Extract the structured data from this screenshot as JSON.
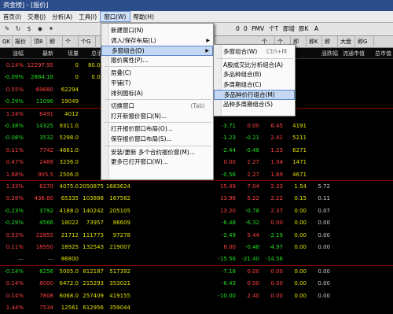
{
  "window": {
    "title": "资金榜] - [报价]"
  },
  "menubar": [
    "首页(I)",
    "交易(J)",
    "分析(A)",
    "工具(I)",
    "窗口(W)",
    "帮助(H)"
  ],
  "toolbar": {
    "icons": [
      "edit-icon",
      "refresh-icon",
      "dollar-icon",
      "tag-icon",
      "pin-icon"
    ],
    "labels": [
      "0",
      "0",
      "PMV",
      "个T",
      "即增",
      "即K",
      "A"
    ]
  },
  "quickbar": [
    "QK",
    "报价",
    "顶8",
    "即",
    "个",
    "个G",
    "个",
    "个",
    "即增",
    "即K",
    "即额",
    "即",
    "即",
    "即胜",
    "即盘",
    "大盘",
    "即",
    "即",
    "即G"
  ],
  "columns": [
    "涨幅",
    "最新",
    "现量",
    "总手",
    "",
    "",
    "",
    "",
    "",
    "",
    "",
    "",
    "",
    "",
    "涨跌幅",
    "流通市值",
    "总市值",
    "上市"
  ],
  "rows": [
    {
      "chg": "0.14%",
      "last": "12297.95",
      "vol": "0",
      "hand": "80.00",
      "amt": "1631741.27",
      "c": "red"
    },
    {
      "chg": "-0.09%",
      "last": "2884.18",
      "vol": "0",
      "hand": "0.00",
      "amt": "1267355",
      "c": "green"
    },
    {
      "chg": "0.55%",
      "last": "69680",
      "vol": "62294",
      "hand": "",
      "amt": "7391",
      "c": "red"
    },
    {
      "chg": "-0.29%",
      "last": "11096",
      "vol": "19049",
      "hand": "",
      "amt": "1551",
      "c": "green"
    },
    {
      "chg": "1.24%",
      "last": "6491",
      "vol": "4012",
      "hand": "",
      "amt": "6339",
      "c": "red"
    },
    {
      "chg": "-0.38%",
      "last": "14325",
      "vol": "9311.0",
      "hand": "",
      "amt": "3000",
      "c": "green"
    },
    {
      "chg": "-0.08%",
      "last": "3532",
      "vol": "5298.0",
      "hand": "",
      "amt": "4231",
      "c": "green"
    },
    {
      "chg": "0.11%",
      "last": "7742",
      "vol": "4661.0",
      "hand": "",
      "amt": "4431",
      "c": "red"
    },
    {
      "chg": "0.47%",
      "last": "2488",
      "vol": "3236.0",
      "hand": "",
      "amt": "1121",
      "c": "red"
    },
    {
      "chg": "1.68%",
      "last": "905.5",
      "vol": "2506.0",
      "hand": "",
      "amt": "2310",
      "c": "red"
    },
    {
      "chg": "1.33%",
      "last": "6270",
      "vol": "4075.0",
      "hand": "2050875",
      "amt": "1683624",
      "c": "red"
    },
    {
      "chg": "0.29%",
      "last": "436.80",
      "vol": "65335",
      "hand": "103888",
      "amt": "167582",
      "c": "red"
    },
    {
      "chg": "-0.23%",
      "last": "3792",
      "vol": "4188.0",
      "hand": "140242",
      "amt": "205105",
      "c": "green"
    },
    {
      "chg": "-0.29%",
      "last": "4566",
      "vol": "18022",
      "hand": "73957",
      "amt": "86609",
      "c": "green"
    },
    {
      "chg": "0.53%",
      "last": "22855",
      "vol": "21712",
      "hand": "111773",
      "amt": "97278",
      "c": "red"
    },
    {
      "chg": "0.11%",
      "last": "18950",
      "vol": "18925",
      "hand": "132543",
      "amt": "219007",
      "c": "red"
    },
    {
      "chg": "—",
      "last": "—",
      "vol": "86800",
      "hand": "",
      "amt": "",
      "c": "gray"
    },
    {
      "chg": "-0.14%",
      "last": "8256",
      "vol": "5005.0",
      "hand": "812187",
      "amt": "517392",
      "c": "green"
    },
    {
      "chg": "0.14%",
      "last": "8000",
      "vol": "6472.0",
      "hand": "215293",
      "amt": "353021",
      "c": "red"
    },
    {
      "chg": "0.14%",
      "last": "7808",
      "vol": "6068.0",
      "hand": "257409",
      "amt": "419155",
      "c": "red"
    },
    {
      "chg": "1.44%",
      "last": "7534",
      "vol": "12561",
      "hand": "612956",
      "amt": "359044",
      "c": "red"
    }
  ],
  "midcols": [
    [
      "",
      "",
      "",
      "",
      "",
      "",
      "",
      "",
      "",
      "",
      "",
      "",
      "",
      "",
      "",
      "",
      "",
      "",
      "",
      ""
    ],
    [
      "",
      "",
      "",
      "",
      "3.55",
      "-3.71",
      "-1.23",
      "-2.44",
      "0.00",
      "-0.56",
      "15.49",
      "13.96",
      "13.20",
      "-6.48",
      "-2.49",
      "8.00",
      "-15.56",
      "-7.18",
      "-6.43",
      "-10.00"
    ]
  ],
  "rightcols": {
    "a": [
      "",
      "",
      "",
      "",
      "1.98",
      "0.00",
      "-0.21",
      "-0.48",
      "2.27",
      "2.27",
      "7.04",
      "5.22",
      "-0.78",
      "-6.32",
      "5.44",
      "-0.48",
      "-21.40",
      "0.00",
      "0.00",
      "2.40"
    ],
    "b": [
      "",
      "",
      "",
      "",
      "1.94",
      "6.45",
      "2.41",
      "1.23",
      "1.04",
      "1.69",
      "2.33",
      "2.22",
      "2.37",
      "0.00",
      "-2.19",
      "-4.97",
      "-14.56",
      "0.00",
      "0.00",
      "0.00"
    ],
    "c": [
      "",
      "",
      "",
      "",
      "",
      "4191",
      "5211",
      "6271",
      "1471",
      "4671",
      "1.54",
      "0.15",
      "0.00",
      "0.00",
      "0.00",
      "0.00",
      "",
      "0.00",
      "0.00",
      "0.00"
    ],
    "d": [
      "",
      "",
      "",
      "",
      "",
      "",
      "",
      "",
      "",
      "",
      "5.72",
      "0.11",
      "0.07",
      "0.00",
      "0.00",
      "0.00",
      "",
      "0.00",
      "0.00",
      "0.00"
    ]
  },
  "menu1": {
    "items": [
      {
        "label": "新建窗口(N)",
        "sc": ""
      },
      {
        "label": "调入/保存布局(L)",
        "sc": "",
        "arrow": true
      },
      {
        "label": "多窗组合(D)",
        "sc": "",
        "arrow": true,
        "hl": true
      },
      {
        "label": "报价属性(P)...",
        "sc": ""
      },
      {
        "label": "",
        "div": true
      },
      {
        "label": "层叠(C)",
        "sc": ""
      },
      {
        "label": "平铺(T)",
        "sc": ""
      },
      {
        "label": "排列图标(A)",
        "sc": ""
      },
      {
        "label": "",
        "div": true
      },
      {
        "label": "切换窗口",
        "sc": "(Tab)"
      },
      {
        "label": "打开新报价窗口(N)...",
        "sc": ""
      },
      {
        "label": "",
        "div": true
      },
      {
        "label": "打开报价窗口布局(O)...",
        "sc": ""
      },
      {
        "label": "保存报价窗口布局(S)...",
        "sc": ""
      },
      {
        "label": "",
        "div": true
      },
      {
        "label": "安装/更新 多个合约报价窗(M)...",
        "sc": ""
      },
      {
        "label": "更多已打开窗口(W)...",
        "sc": ""
      }
    ]
  },
  "menu2": {
    "items": [
      {
        "label": "多窗组合(W)",
        "sc": "Ctrl+M"
      },
      {
        "label": "",
        "div": true
      },
      {
        "label": "A股成交比分析组合(A)",
        "sc": ""
      },
      {
        "label": "多品种组合(B)",
        "sc": ""
      },
      {
        "label": "多周期组合(C)",
        "sc": ""
      },
      {
        "label": "多品种价行组合(M)",
        "sc": "",
        "hl": true
      },
      {
        "label": "品种多周期组合(S)",
        "sc": ""
      }
    ]
  }
}
